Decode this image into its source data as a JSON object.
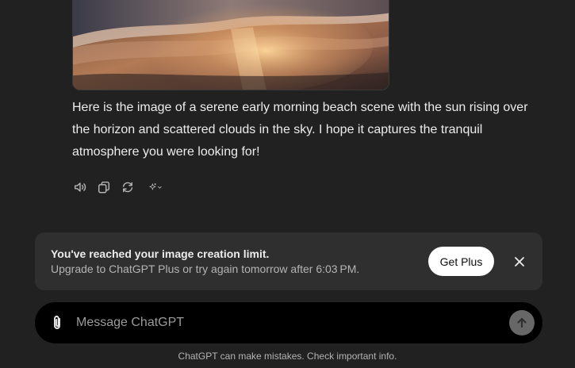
{
  "message": {
    "image_alt": "Sunrise beach with waves reflecting golden light",
    "text": "Here is the image of a serene early morning beach scene with the sun rising over the horizon and scattered clouds in the sky. I hope it captures the tranquil atmosphere you were looking for!",
    "actions": [
      {
        "icon": "speaker-icon"
      },
      {
        "icon": "copy-icon"
      },
      {
        "icon": "regenerate-icon"
      },
      {
        "icon": "sparkle-model-icon"
      }
    ]
  },
  "limit_banner": {
    "title": "You've reached your image creation limit.",
    "subtitle": "Upgrade to ChatGPT Plus or try again tomorrow after 6:03 PM.",
    "cta_label": "Get Plus",
    "close_icon": "close-icon"
  },
  "composer": {
    "placeholder": "Message ChatGPT",
    "value": "",
    "attach_icon": "paperclip-icon",
    "send_icon": "arrow-up-icon"
  },
  "footer": {
    "disclaimer": "ChatGPT can make mistakes. Check important info."
  },
  "colors": {
    "background": "#212121",
    "banner": "#2f2f2f",
    "composer": "#000000",
    "cta_bg": "#ffffff",
    "send_bg": "#676767"
  }
}
